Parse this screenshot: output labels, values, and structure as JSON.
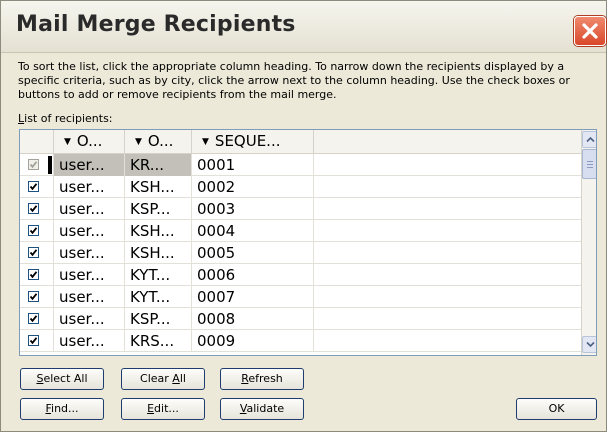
{
  "dialog": {
    "title": "Mail Merge Recipients",
    "instructions": "To sort the list, click the appropriate column heading.  To narrow down the recipients displayed by a specific criteria, such as by city, click the arrow next to the column heading.  Use the check boxes or buttons to add or remove recipients from the mail merge.",
    "list_label_accesskey": "L",
    "list_label_rest": "ist of recipients:"
  },
  "columns": [
    "O...",
    "O...",
    "SEQUE..."
  ],
  "rows": [
    {
      "checked": true,
      "selected": true,
      "col1": "user...",
      "col2": "KR...",
      "col3": "0001"
    },
    {
      "checked": true,
      "selected": false,
      "col1": "user...",
      "col2": "KSH...",
      "col3": "0002"
    },
    {
      "checked": true,
      "selected": false,
      "col1": "user...",
      "col2": "KSP...",
      "col3": "0003"
    },
    {
      "checked": true,
      "selected": false,
      "col1": "user...",
      "col2": "KSH...",
      "col3": "0004"
    },
    {
      "checked": true,
      "selected": false,
      "col1": "user...",
      "col2": "KSH...",
      "col3": "0005"
    },
    {
      "checked": true,
      "selected": false,
      "col1": "user...",
      "col2": "KYT...",
      "col3": "0006"
    },
    {
      "checked": true,
      "selected": false,
      "col1": "user...",
      "col2": "KYT...",
      "col3": "0007"
    },
    {
      "checked": true,
      "selected": false,
      "col1": "user...",
      "col2": "KSP...",
      "col3": "0008"
    },
    {
      "checked": true,
      "selected": false,
      "col1": "user...",
      "col2": "KRS...",
      "col3": "0009"
    }
  ],
  "buttons": {
    "select_all": {
      "key": "S",
      "rest": "elect All"
    },
    "clear_all": {
      "pre": "Clear ",
      "key": "A",
      "rest": "ll"
    },
    "refresh": {
      "key": "R",
      "rest": "efresh"
    },
    "find": {
      "key": "F",
      "rest": "ind..."
    },
    "edit": {
      "key": "E",
      "rest": "dit..."
    },
    "validate": {
      "key": "V",
      "rest": "alidate"
    },
    "ok": "OK"
  },
  "colors": {
    "close_button": "#d9472a",
    "checkbox_border": "#1c5180",
    "button_border": "#1f3c6e",
    "selected_row": "#c2c0b8"
  },
  "icons": {
    "close": "close-icon",
    "sort_dropdown": "dropdown-arrow-icon",
    "checkmark": "checkmark-icon",
    "scroll_up": "scroll-up-icon",
    "scroll_down": "scroll-down-icon"
  }
}
